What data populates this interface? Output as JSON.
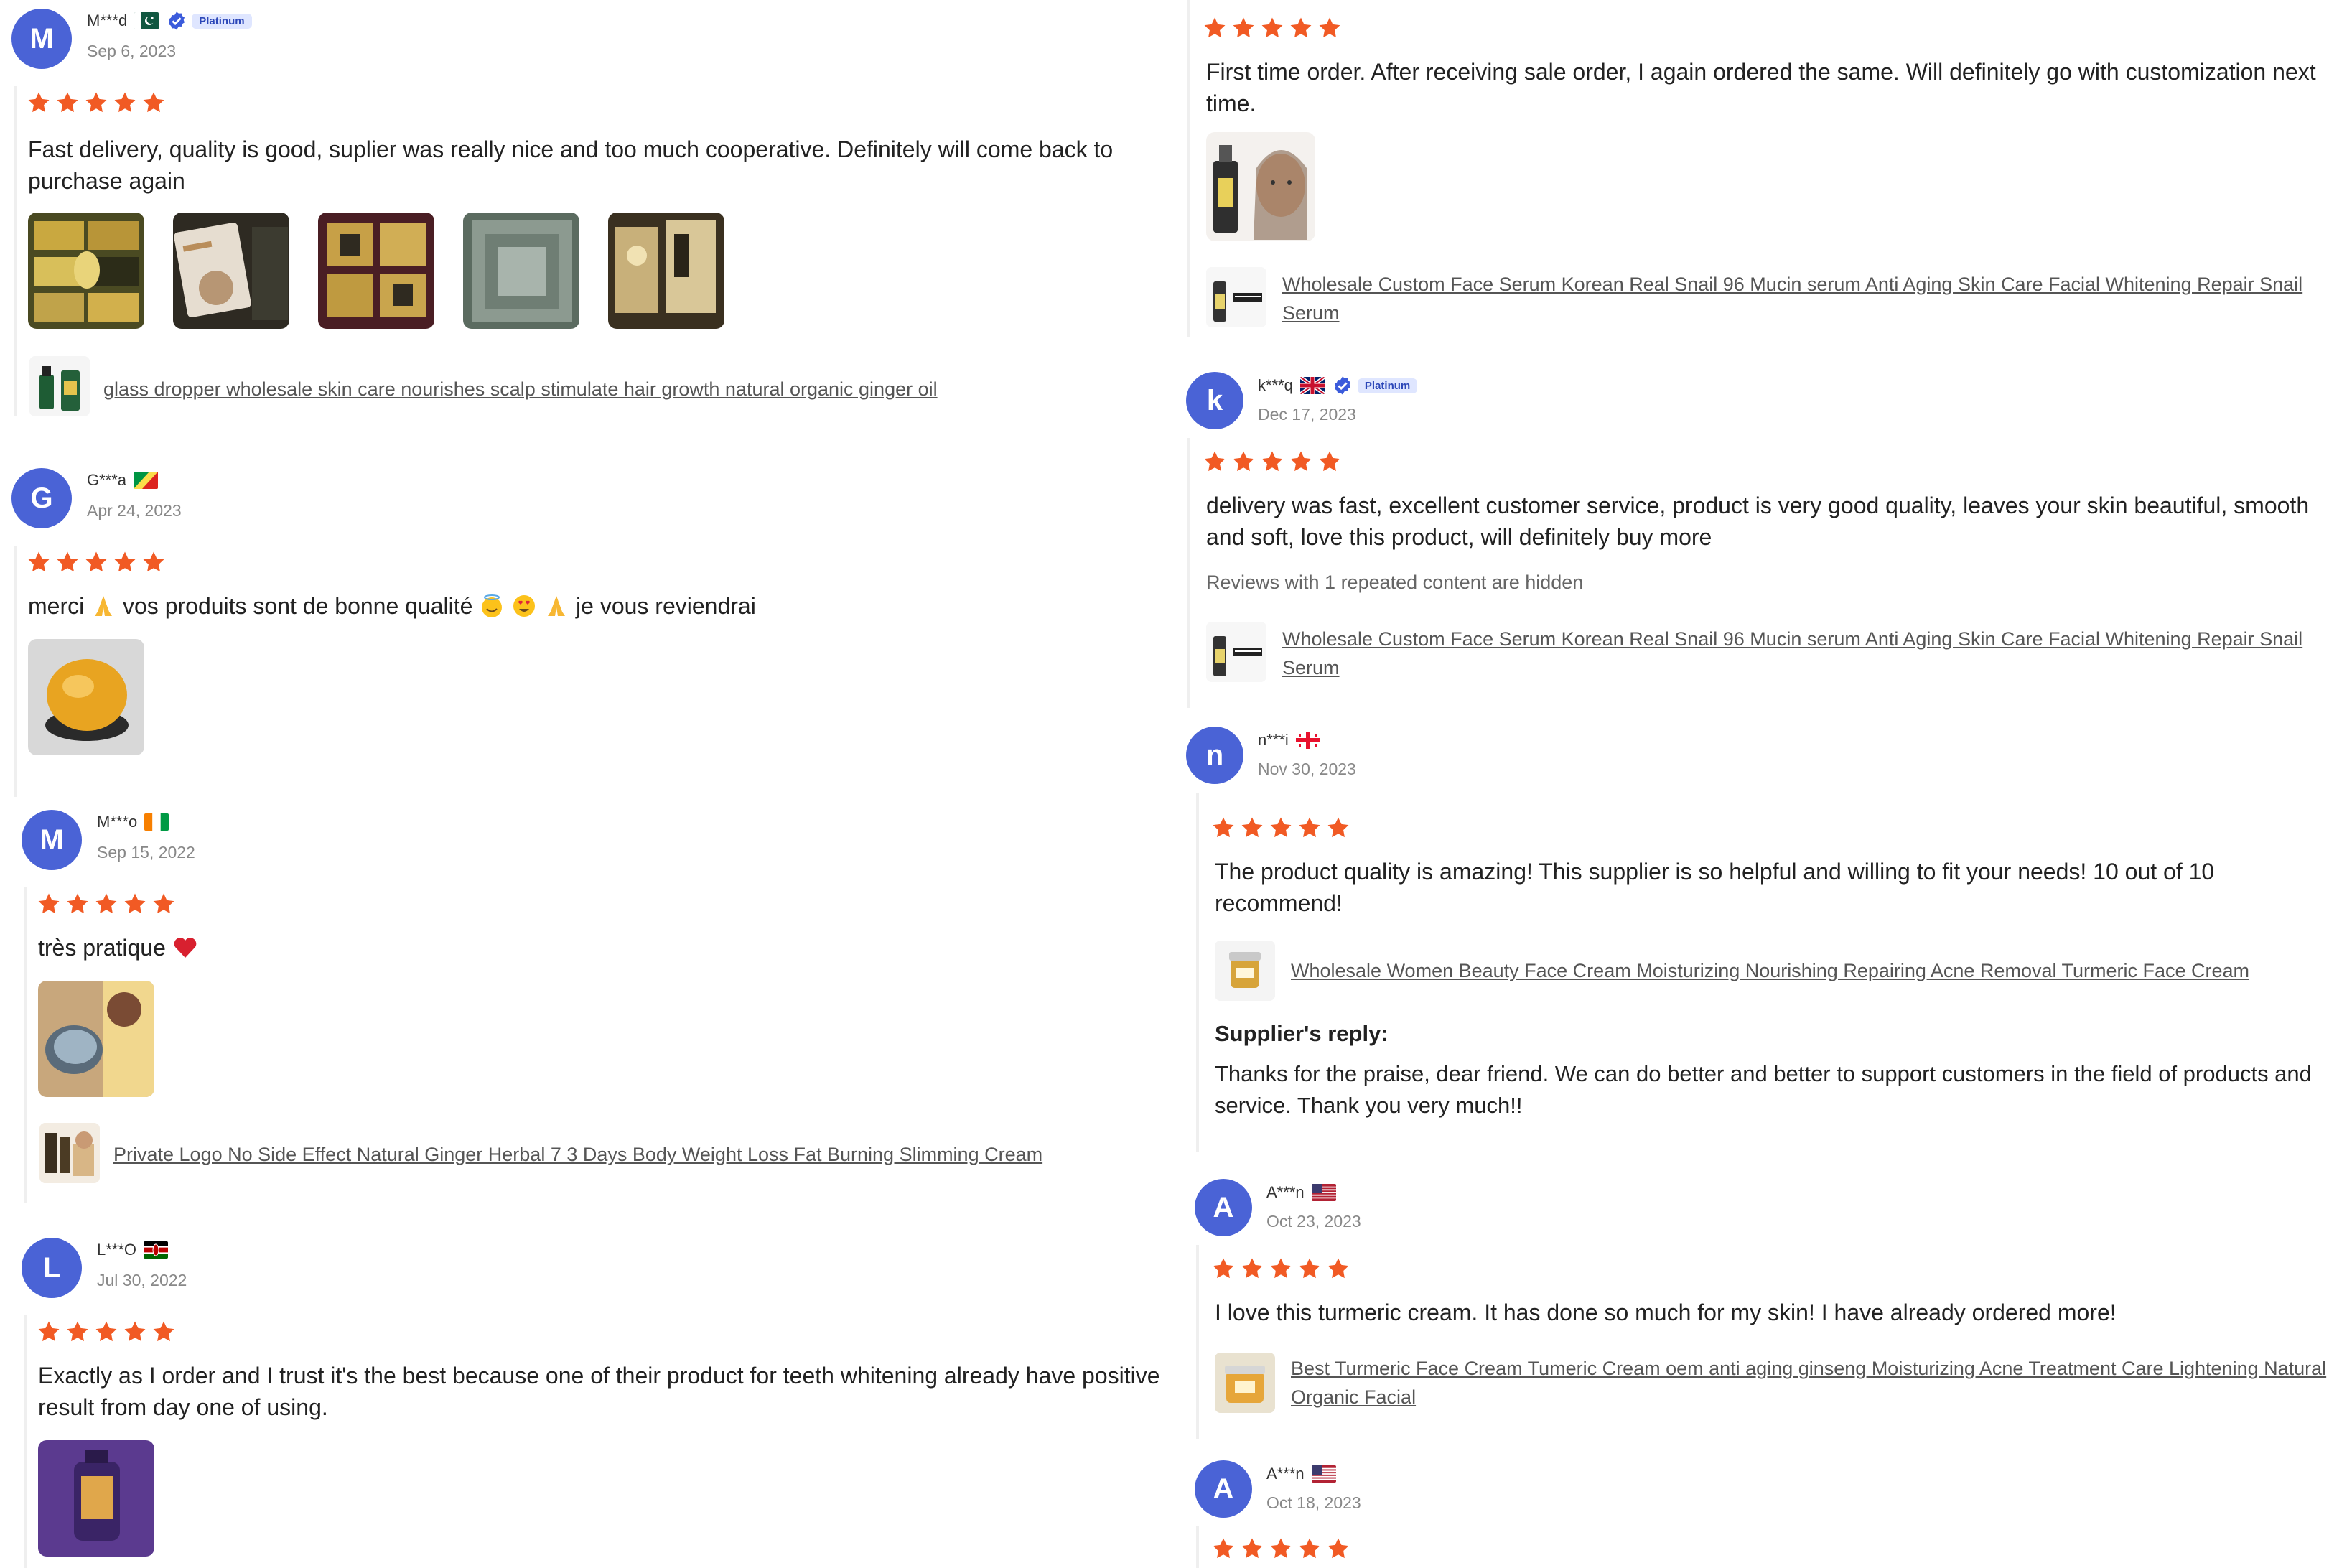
{
  "colors": {
    "star": "#f15a24",
    "avatar": "#4a63d6",
    "link": "#555555",
    "rail": "#efefef",
    "badge_bg": "#dfe6ff"
  },
  "left": {
    "reviews": [
      {
        "avatar_letter": "M",
        "user": "M***d",
        "flag": "pakistan-flag-icon",
        "badge": "Platinum",
        "date": "Sep 6, 2023",
        "stars": 5,
        "text": "Fast delivery, quality is good, suplier was really nice and too much cooperative. Definitely will come back to purchase again",
        "product": "glass dropper wholesale skin care nourishes scalp stimulate hair growth natural organic ginger oil"
      },
      {
        "avatar_letter": "G",
        "user": "G***a",
        "flag": "congo-flag-icon",
        "date": "Apr 24, 2023",
        "stars": 5,
        "text_parts": [
          "merci",
          "vos produits sont de bonne qualité",
          "je vous reviendrai"
        ]
      },
      {
        "avatar_letter": "M",
        "user": "M***o",
        "flag": "ireland-flag-icon",
        "date": "Sep 15, 2022",
        "stars": 5,
        "text": "très pratique",
        "product": "Private Logo No Side Effect Natural Ginger Herbal 7 3 Days Body Weight Loss Fat Burning Slimming Cream"
      },
      {
        "avatar_letter": "L",
        "user": "L***O",
        "flag": "kenya-flag-icon",
        "date": "Jul 30, 2022",
        "stars": 5,
        "text": "Exactly as I order and I trust it's the best because one of their product for teeth whitening already have positive result from day one of using."
      }
    ]
  },
  "right": {
    "reviews": [
      {
        "stars": 5,
        "text": "First time order. After receiving sale order, I again ordered the same. Will definitely go with customization next time.",
        "product": "Wholesale Custom Face Serum Korean Real Snail 96 Mucin serum Anti Aging Skin Care Facial Whitening Repair Snail Serum"
      },
      {
        "avatar_letter": "k",
        "user": "k***q",
        "flag": "uk-flag-icon",
        "badge": "Platinum",
        "date": "Dec 17, 2023",
        "stars": 5,
        "text": "delivery was fast, excellent customer service, product is very good quality, leaves your skin beautiful, smooth and soft, love this product, will definitely buy more",
        "hidden_note": "Reviews with 1 repeated content are hidden",
        "product": "Wholesale Custom Face Serum Korean Real Snail 96 Mucin serum Anti Aging Skin Care Facial Whitening Repair Snail Serum"
      },
      {
        "avatar_letter": "n",
        "user": "n***i",
        "flag": "georgia-flag-icon",
        "date": "Nov 30, 2023",
        "stars": 5,
        "text": "The product quality is amazing! This supplier is so helpful and willing to fit your needs! 10 out of 10 recommend!",
        "product": "Wholesale Women Beauty Face Cream Moisturizing Nourishing Repairing Acne Removal Turmeric Face Cream",
        "reply_title": "Supplier's reply:",
        "reply_text": "Thanks for the praise, dear friend. We can do better and better to support customers in the field of products and service. Thank you very much!!"
      },
      {
        "avatar_letter": "A",
        "user": "A***n",
        "flag": "usa-flag-icon",
        "date": "Oct 23, 2023",
        "stars": 5,
        "text": "I love this turmeric cream. It has done so much for my skin! I have already ordered more!",
        "product": "Best Turmeric Face Cream Tumeric Cream oem anti aging ginseng Moisturizing Acne Treatment Care Lightening Natural Organic Facial"
      },
      {
        "avatar_letter": "A",
        "user": "A***n",
        "flag": "usa-flag-icon",
        "date": "Oct 18, 2023",
        "stars": 5
      }
    ]
  }
}
